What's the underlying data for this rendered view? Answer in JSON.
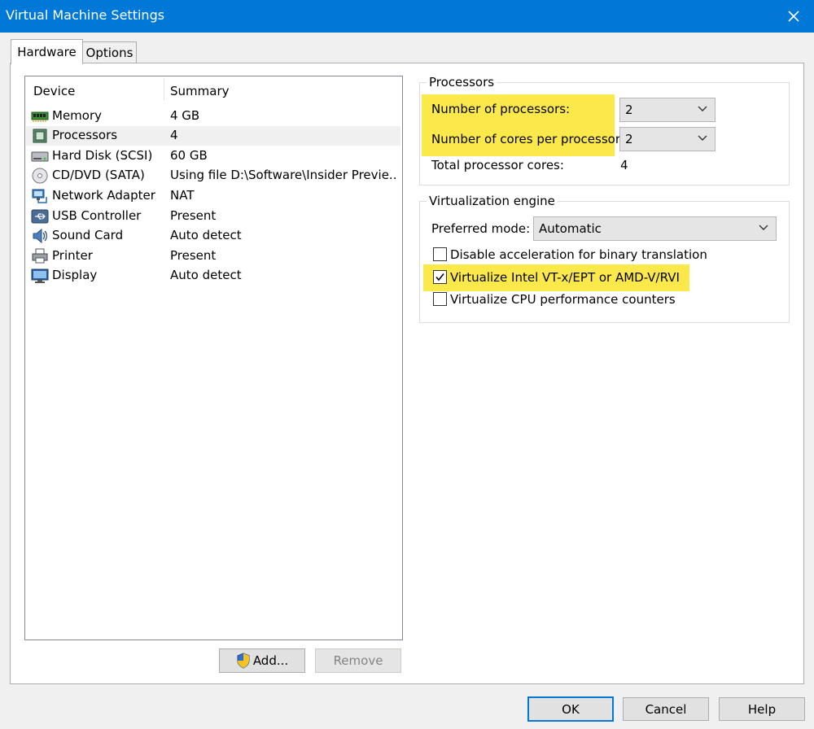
{
  "window": {
    "title": "Virtual Machine Settings",
    "close_glyph": "✕"
  },
  "tabs": [
    {
      "label": "Hardware",
      "active": true
    },
    {
      "label": "Options",
      "active": false
    }
  ],
  "device_list": {
    "headers": {
      "device": "Device",
      "summary": "Summary"
    },
    "rows": [
      {
        "icon": "memory-icon",
        "name": "Memory",
        "summary": "4 GB"
      },
      {
        "icon": "processor-icon",
        "name": "Processors",
        "summary": "4",
        "selected": true
      },
      {
        "icon": "hard-disk-icon",
        "name": "Hard Disk (SCSI)",
        "summary": "60 GB"
      },
      {
        "icon": "cd-dvd-icon",
        "name": "CD/DVD (SATA)",
        "summary": "Using file D:\\Software\\Insider Previe..."
      },
      {
        "icon": "network-adapter-icon",
        "name": "Network Adapter",
        "summary": "NAT"
      },
      {
        "icon": "usb-icon",
        "name": "USB Controller",
        "summary": "Present"
      },
      {
        "icon": "sound-card-icon",
        "name": "Sound Card",
        "summary": "Auto detect"
      },
      {
        "icon": "printer-icon",
        "name": "Printer",
        "summary": "Present"
      },
      {
        "icon": "display-icon",
        "name": "Display",
        "summary": "Auto detect"
      }
    ]
  },
  "buttons": {
    "add": "Add...",
    "remove": "Remove",
    "ok": "OK",
    "cancel": "Cancel",
    "help": "Help"
  },
  "processors": {
    "group_title": "Processors",
    "num_processors_label": "Number of processors:",
    "num_processors_value": "2",
    "cores_per_processor_label": "Number of cores per processor:",
    "cores_per_processor_value": "2",
    "total_cores_label": "Total processor cores:",
    "total_cores_value": "4"
  },
  "virtualization": {
    "group_title": "Virtualization engine",
    "preferred_mode_label": "Preferred mode:",
    "preferred_mode_value": "Automatic",
    "options": [
      {
        "label": "Disable acceleration for binary translation",
        "checked": false
      },
      {
        "label": "Virtualize Intel VT-x/EPT or AMD-V/RVI",
        "checked": true
      },
      {
        "label": "Virtualize CPU performance counters",
        "checked": false
      }
    ]
  },
  "colors": {
    "title_bar": "#0078d7",
    "highlight": "#fbe94b",
    "selected_row": "#f0f0f0"
  }
}
